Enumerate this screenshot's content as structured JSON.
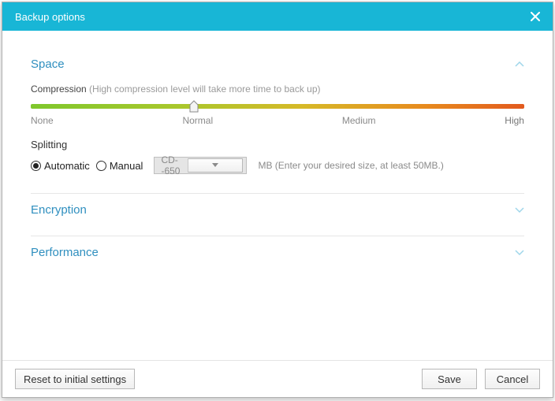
{
  "window": {
    "title": "Backup options"
  },
  "sections": {
    "space": {
      "title": "Space",
      "compression": {
        "label": "Compression",
        "hint": "(High compression level will take more time to back up)",
        "levels": [
          "None",
          "Normal",
          "Medium",
          "High"
        ],
        "value_index": 1,
        "value_percent": 33
      },
      "splitting": {
        "title": "Splitting",
        "options": {
          "automatic": "Automatic",
          "manual": "Manual"
        },
        "selected": "automatic",
        "preset": "CD--650",
        "hint": "MB (Enter your desired size, at least 50MB.)"
      }
    },
    "encryption": {
      "title": "Encryption"
    },
    "performance": {
      "title": "Performance"
    }
  },
  "footer": {
    "reset": "Reset to initial settings",
    "save": "Save",
    "cancel": "Cancel"
  }
}
